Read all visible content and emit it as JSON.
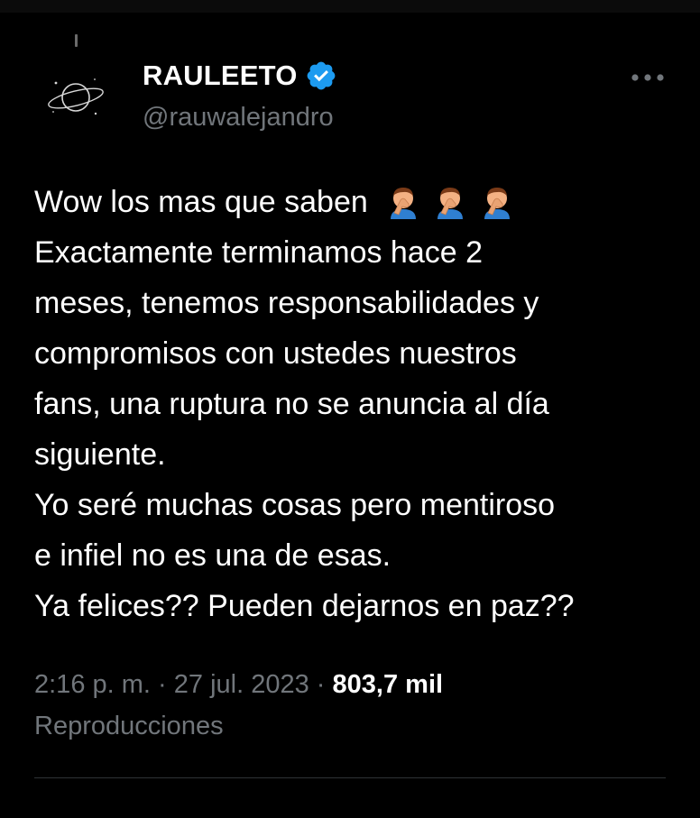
{
  "tweet": {
    "display_name": "RAULEETO",
    "handle": "@rauwalejandro",
    "verified": true,
    "text_lines": [
      "Wow los mas que saben",
      "Exactamente terminamos hace 2",
      "meses, tenemos responsabilidades y",
      "compromisos con ustedes nuestros",
      "fans, una ruptura no se anuncia al día",
      "siguiente.",
      "Yo seré muchas cosas pero mentiroso",
      "e infiel no es una de esas.",
      "Ya felices?? Pueden dejarnos en paz??"
    ],
    "emoji": [
      "facepalm-emoji",
      "facepalm-emoji",
      "facepalm-emoji"
    ],
    "time": "2:16 p. m.",
    "separator": "·",
    "date": "27 jul. 2023",
    "views_count": "803,7 mil",
    "views_label": "Reproducciones"
  },
  "colors": {
    "background": "#000000",
    "text_primary": "#ffffff",
    "text_secondary": "#71767b",
    "verified_blue": "#1d9bf0",
    "divider": "#2f3336"
  },
  "icons": {
    "avatar": "planet-doodle-icon",
    "verified": "verified-badge-icon",
    "more": "more-options-icon"
  }
}
